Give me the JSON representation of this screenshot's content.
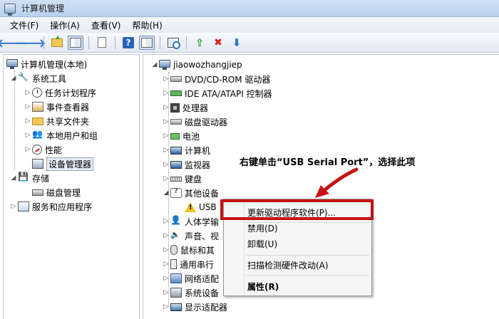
{
  "window": {
    "title": "计算机管理"
  },
  "menubar": [
    {
      "label": "文件(F)"
    },
    {
      "label": "操作(A)"
    },
    {
      "label": "查看(V)"
    },
    {
      "label": "帮助(H)"
    }
  ],
  "toolbar_icons": [
    "back-icon",
    "forward-icon",
    "up-folder-icon",
    "show-hide-tree-icon",
    "properties-icon",
    "help-icon",
    "action-pane-icon",
    "scan-hardware-icon",
    "update-driver-icon",
    "uninstall-icon",
    "disable-icon"
  ],
  "left_tree": {
    "root": "计算机管理(本地)",
    "system_tools": "系统工具",
    "task_scheduler": "任务计划程序",
    "event_viewer": "事件查看器",
    "shared_folders": "共享文件夹",
    "local_users": "本地用户和组",
    "performance": "性能",
    "device_manager": "设备管理器",
    "storage": "存储",
    "disk_management": "磁盘管理",
    "services_apps": "服务和应用程序"
  },
  "device_tree": {
    "root": "jiaowozhangjiep",
    "dvd": "DVD/CD-ROM 驱动器",
    "ide": "IDE ATA/ATAPI 控制器",
    "cpu": "处理器",
    "disk": "磁盘驱动器",
    "battery": "电池",
    "computer": "计算机",
    "monitor": "监视器",
    "keyboard": "键盘",
    "other": "其他设备",
    "usb_serial": "USB",
    "hid": "人体学输",
    "sound": "声音、视",
    "mouse": "鼠标和其",
    "usb_ctrl": "通用串行",
    "network": "网络适配",
    "system": "系统设备",
    "display": "显示适配器"
  },
  "annotation": {
    "text": "右键单击“USB Serial Port”，选择此项",
    "color": "#c41414"
  },
  "context_menu": {
    "update_driver": "更新驱动程序软件(P)...",
    "disable": "禁用(D)",
    "uninstall": "卸载(U)",
    "scan": "扫描检测硬件改动(A)",
    "properties": "属性(R)"
  }
}
